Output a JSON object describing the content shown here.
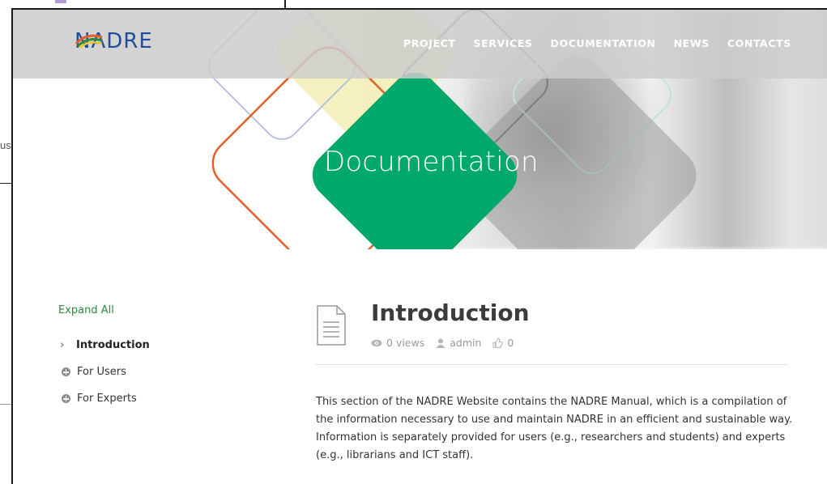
{
  "background": {
    "partial_text": "us"
  },
  "header": {
    "logo_text": "NADRE",
    "nav": [
      "PROJECT",
      "SERVICES",
      "DOCUMENTATION",
      "NEWS",
      "CONTACTS"
    ]
  },
  "hero": {
    "title": "Documentation"
  },
  "sidebar": {
    "expand_all": "Expand All",
    "items": [
      {
        "label": "Introduction",
        "icon": "chevron-right-icon",
        "active": true
      },
      {
        "label": "For Users",
        "icon": "plus-circle-icon"
      },
      {
        "label": "For Experts",
        "icon": "plus-circle-icon"
      }
    ]
  },
  "article": {
    "title": "Introduction",
    "views": "0 views",
    "author": "admin",
    "likes": "0",
    "body": "This section of the NADRE Website contains the NADRE Manual, which is a compilation of the information necessary to use and maintain NADRE in an efficient and sustainable way. Information is separately provided for users (e.g., researchers and students) and experts (e.g., librarians and ICT staff)."
  },
  "colors": {
    "accent_green": "#00a86b",
    "accent_orange": "#e0602a",
    "logo_blue": "#1f4e9a",
    "link_green": "#2c8a3a"
  }
}
